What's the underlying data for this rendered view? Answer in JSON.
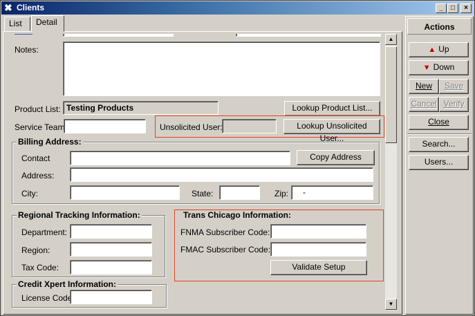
{
  "window": {
    "title": "Clients",
    "controls": {
      "minimize": "_",
      "maximize": "□",
      "close": "×"
    }
  },
  "tabs": [
    {
      "label": "List",
      "active": false
    },
    {
      "label": "Detail",
      "active": true
    }
  ],
  "detail": {
    "notes_label": "Notes:",
    "notes_value": "",
    "product_list_label": "Product List:",
    "product_list_value": "Testing Products",
    "lookup_product_button": "Lookup Product List...",
    "service_team_label": "Service Team:",
    "service_team_value": "",
    "unsolicited_user_label": "Unsolicited User:",
    "unsolicited_user_value": "",
    "lookup_unsolicited_button": "Lookup Unsolicited User...",
    "billing": {
      "legend": "Billing Address:",
      "contact_label": "Contact",
      "contact_value": "",
      "copy_address_button": "Copy Address",
      "address_label": "Address:",
      "address_value": "",
      "city_label": "City:",
      "city_value": "",
      "state_label": "State:",
      "state_value": "",
      "zip_label": "Zip:",
      "zip_value": "-"
    },
    "regional": {
      "legend": "Regional Tracking Information:",
      "department_label": "Department:",
      "department_value": "",
      "region_label": "Region:",
      "region_value": "",
      "tax_code_label": "Tax Code:",
      "tax_code_value": ""
    },
    "trans_chicago": {
      "legend": "Trans Chicago Information:",
      "fnma_label": "FNMA Subscriber Code:",
      "fnma_value": "",
      "fmac_label": "FMAC Subscriber Code:",
      "fmac_value": "",
      "validate_button": "Validate Setup"
    },
    "credit_xpert": {
      "legend": "Credit Xpert Information:",
      "license_label": "License Code:",
      "license_value": ""
    }
  },
  "actions": {
    "header": "Actions",
    "up": "Up",
    "down": "Down",
    "new": "New",
    "save": "Save",
    "cancel": "Cancel",
    "verify": "Verify",
    "close": "Close",
    "search": "Search...",
    "users": "Users..."
  },
  "colors": {
    "highlight_border": "#e0421c",
    "title_gradient_start": "#0a246a",
    "arrow": "#c00000"
  }
}
